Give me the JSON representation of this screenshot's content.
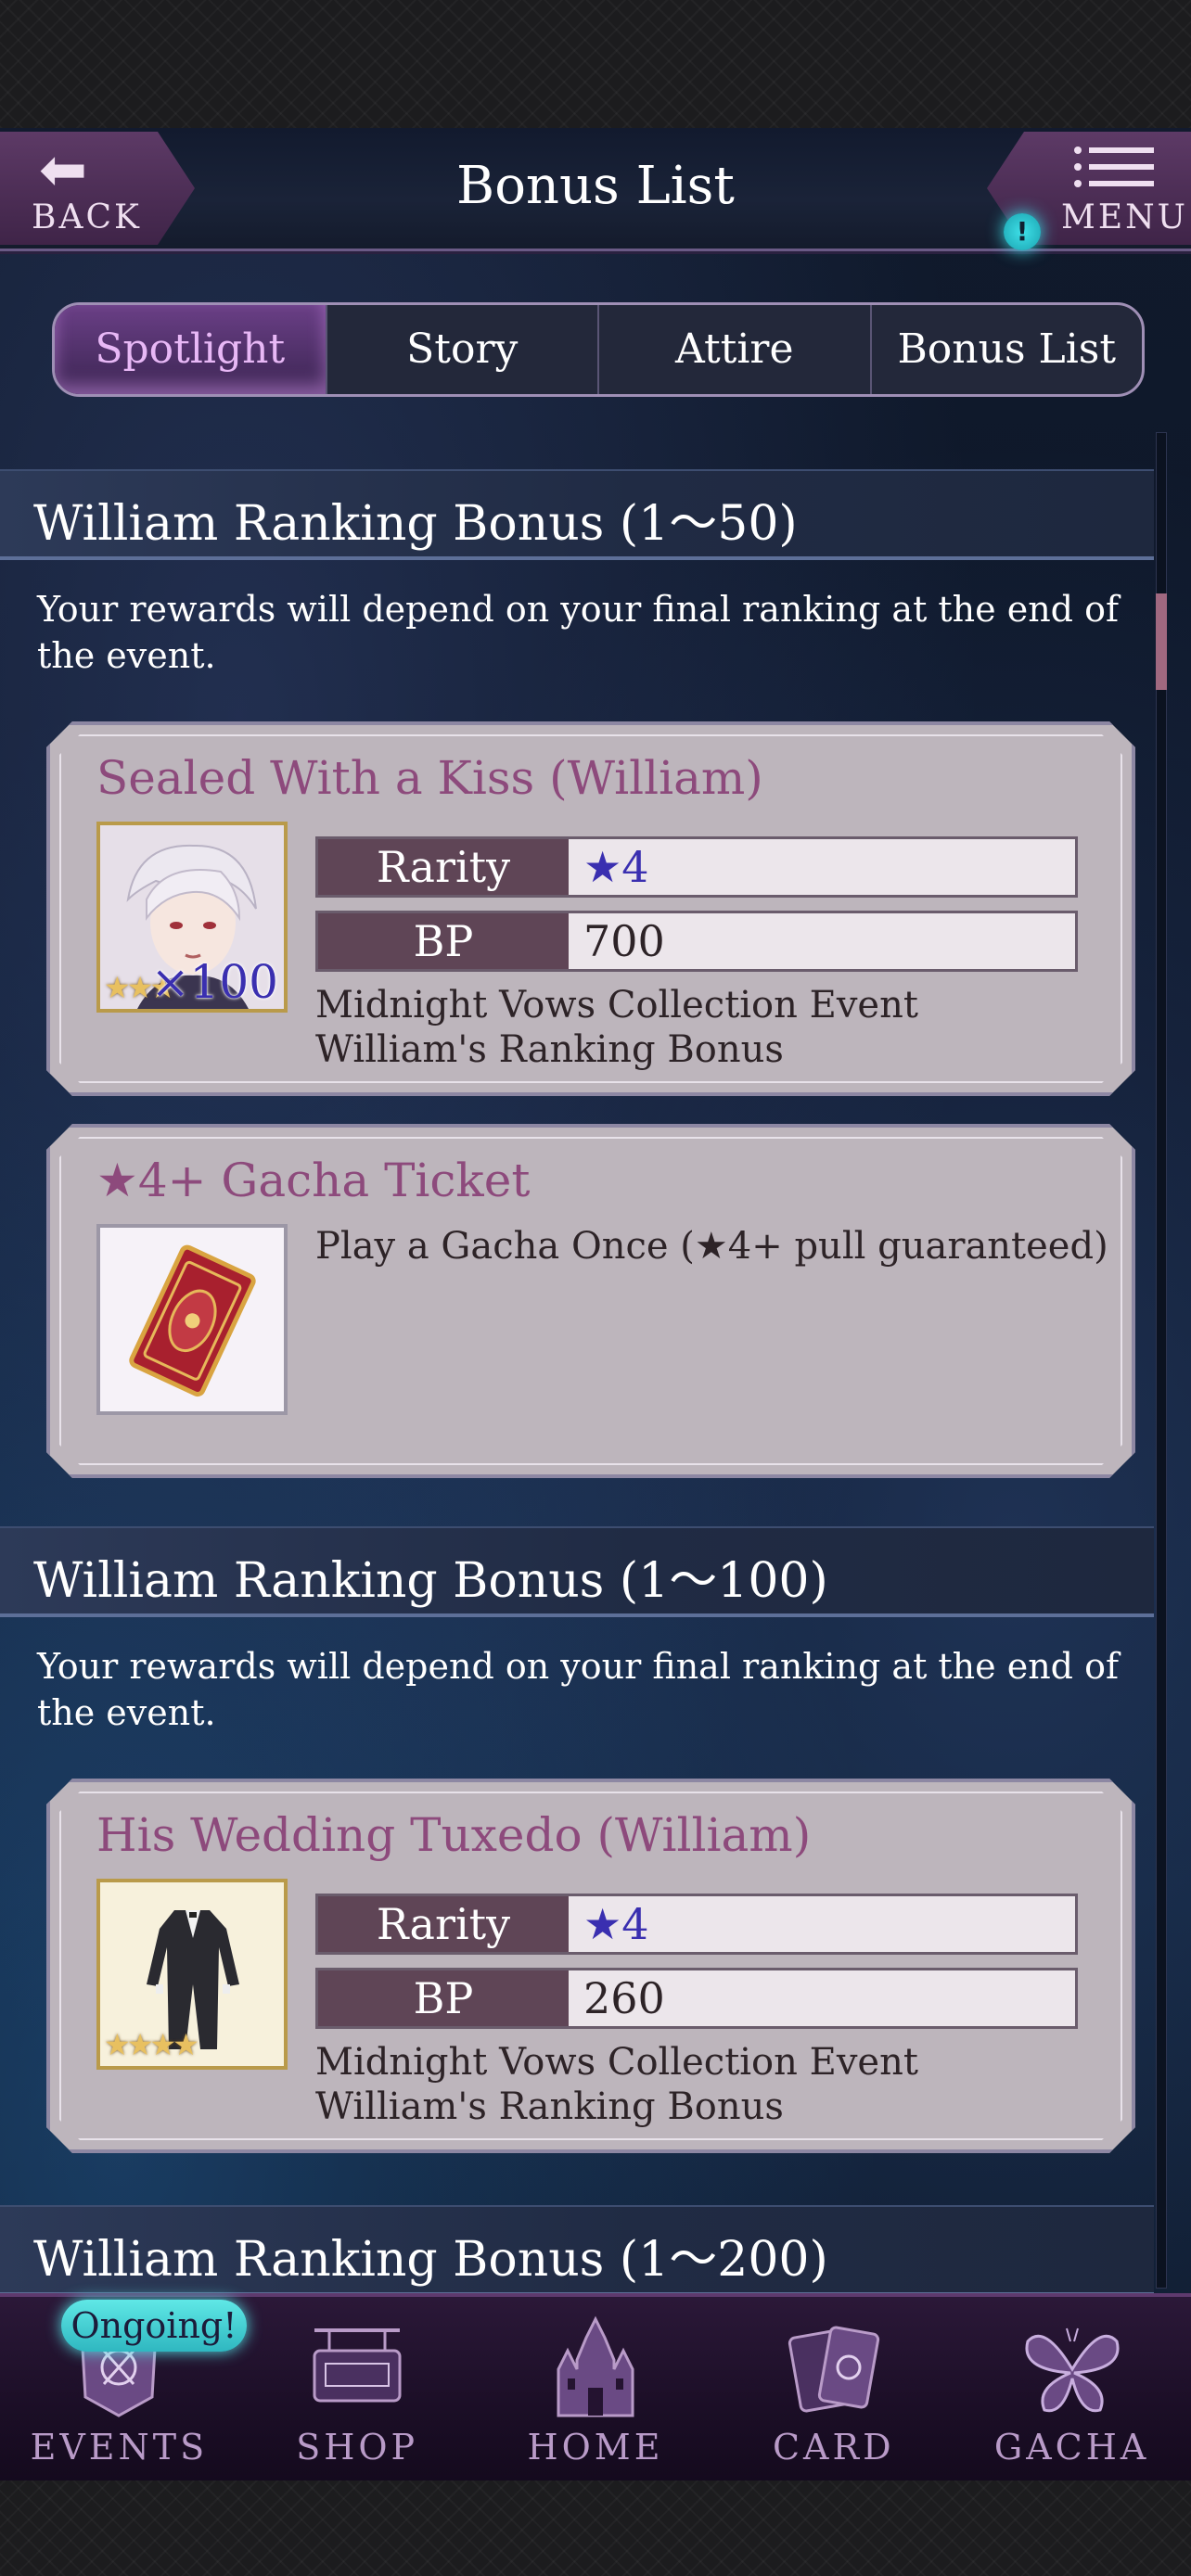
{
  "header": {
    "back_label": "BACK",
    "title": "Bonus List",
    "menu_label": "MENU",
    "menu_badge": "!"
  },
  "tabs": [
    {
      "label": "Spotlight",
      "active": true
    },
    {
      "label": "Story",
      "active": false
    },
    {
      "label": "Attire",
      "active": false
    },
    {
      "label": "Bonus List",
      "active": false
    }
  ],
  "sections": [
    {
      "title": "William Ranking Bonus (1～50)",
      "description": "Your rewards will depend on your final ranking at the end of the event.",
      "cards": [
        {
          "title": "Sealed With a Kiss (William)",
          "thumb_icon": "william-portrait-icon",
          "thumb_stars": "★★★",
          "thumb_qty": "×100",
          "rarity_label": "Rarity",
          "rarity_value": "★4",
          "bp_label": "BP",
          "bp_value": "700",
          "desc": "Midnight Vows Collection Event\nWilliam's Ranking Bonus"
        },
        {
          "title": "★4+ Gacha Ticket",
          "thumb_icon": "gacha-ticket-icon",
          "desc": "Play a Gacha Once (★4+ pull guaranteed)"
        }
      ]
    },
    {
      "title": "William Ranking Bonus (1～100)",
      "description": "Your rewards will depend on your final ranking at the end of the event.",
      "cards": [
        {
          "title": "His Wedding Tuxedo (William)",
          "thumb_icon": "tuxedo-icon",
          "thumb_stars": "★★★★",
          "rarity_label": "Rarity",
          "rarity_value": "★4",
          "bp_label": "BP",
          "bp_value": "260",
          "desc": "Midnight Vows Collection Event\nWilliam's Ranking Bonus"
        }
      ]
    },
    {
      "title": "William Ranking Bonus (1～200)"
    }
  ],
  "nav": {
    "ongoing_badge": "Ongoing!",
    "items": [
      {
        "label": "EVENTS",
        "icon": "events-icon"
      },
      {
        "label": "SHOP",
        "icon": "shop-icon"
      },
      {
        "label": "HOME",
        "icon": "castle-icon"
      },
      {
        "label": "CARD",
        "icon": "card-icon"
      },
      {
        "label": "GACHA",
        "icon": "butterfly-icon"
      }
    ]
  },
  "colors": {
    "accent_pink": "#8d4a7c",
    "rarity_blue": "#3a2fb0",
    "tab_active": "#e8b8f6",
    "badge_cyan": "#3fe0e8"
  }
}
